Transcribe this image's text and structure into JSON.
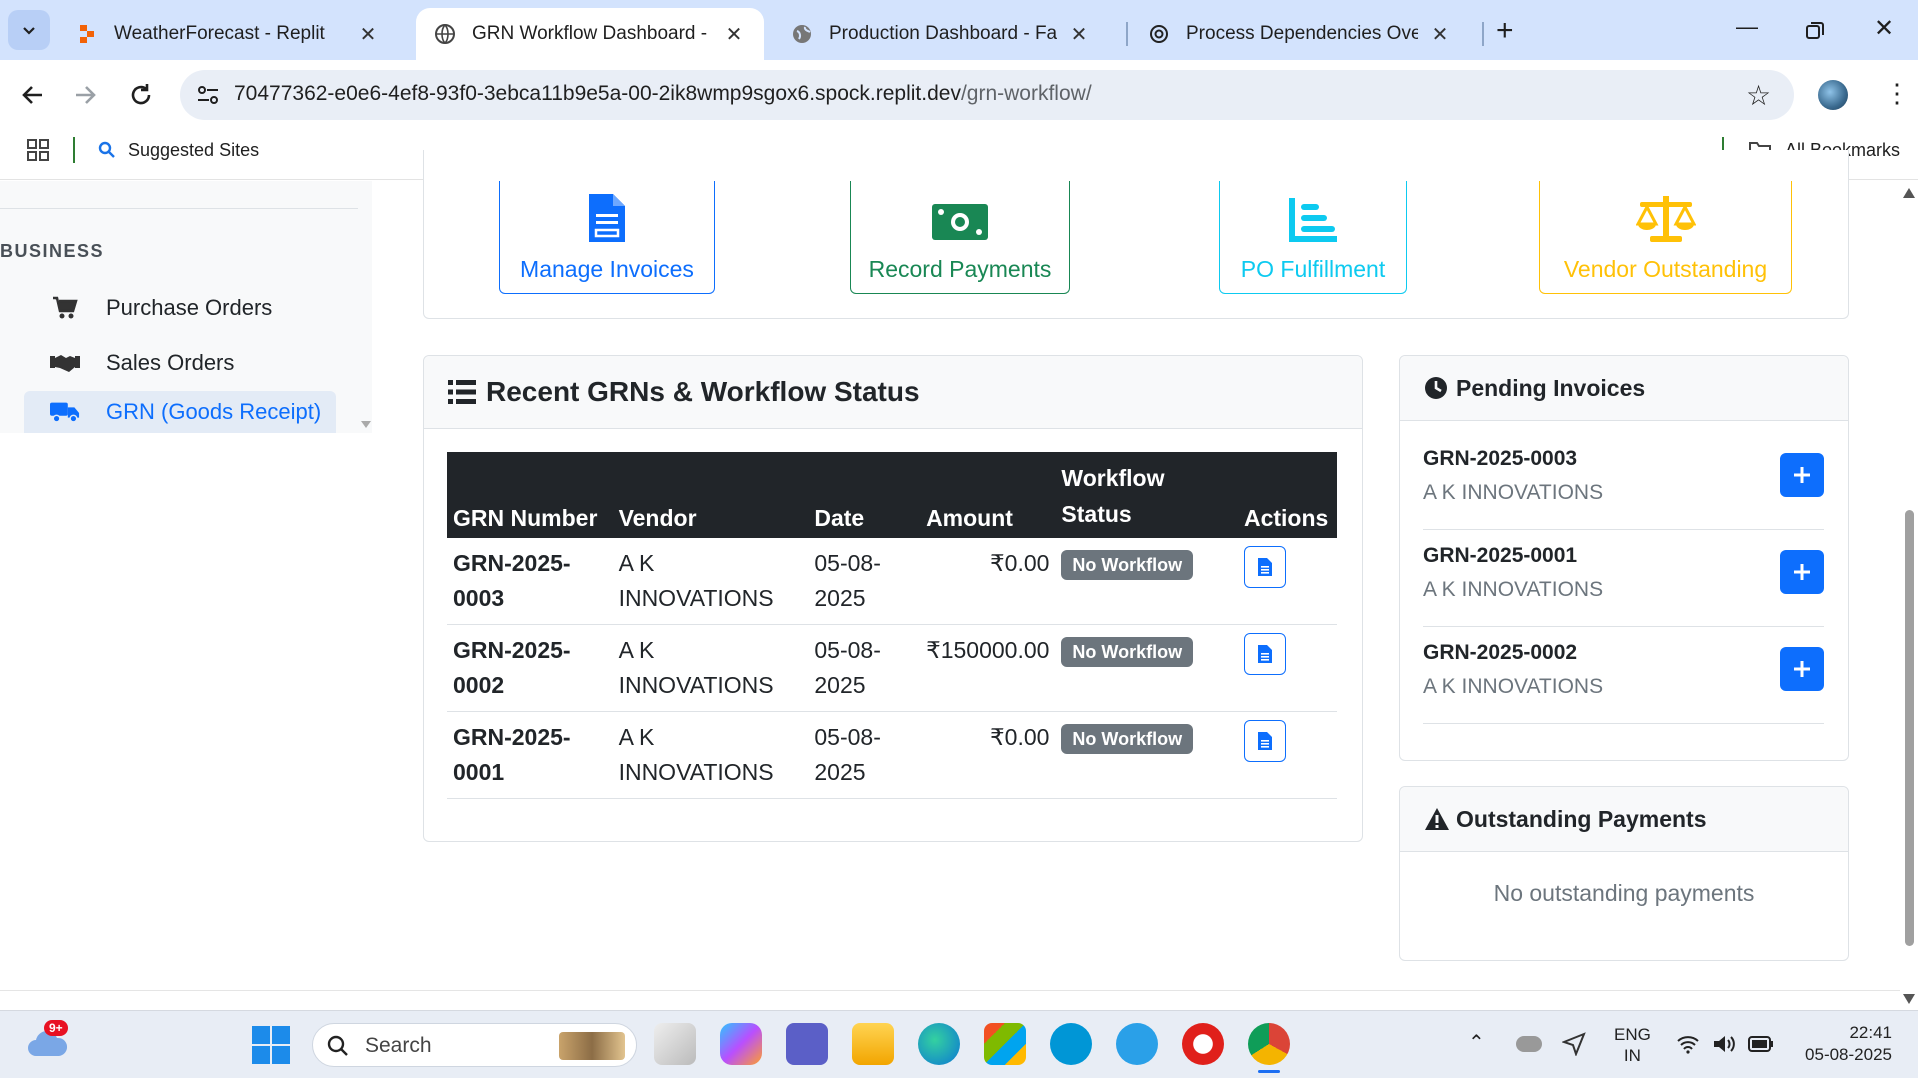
{
  "browser": {
    "tabs": [
      {
        "title": "WeatherForecast - Replit",
        "active": false
      },
      {
        "title": "GRN Workflow Dashboard - Factory",
        "active": true
      },
      {
        "title": "Production Dashboard - Factory",
        "active": false
      },
      {
        "title": "Process Dependencies Overview",
        "active": false
      }
    ],
    "url_main": "70477362-e0e6-4ef8-93f0-3ebca11b9e5a-00-2ik8wmp9sgox6.spock.replit.dev",
    "url_path": "/grn-workflow/",
    "bookmarks": {
      "suggested": "Suggested Sites",
      "all": "All Bookmarks"
    }
  },
  "sidebar": {
    "section": "BUSINESS",
    "items": [
      {
        "label": "Purchase Orders",
        "icon": "cart-icon"
      },
      {
        "label": "Sales Orders",
        "icon": "handshake-icon"
      },
      {
        "label": "GRN (Goods Receipt)",
        "icon": "truck-icon",
        "active": true
      }
    ]
  },
  "quick_actions": [
    {
      "label": "Manage Invoices",
      "icon": "invoice-icon",
      "color": "#0d6efd"
    },
    {
      "label": "Record Payments",
      "icon": "money-icon",
      "color": "#198754"
    },
    {
      "label": "PO Fulfillment",
      "icon": "chart-bars-icon",
      "color": "#0dcaf0"
    },
    {
      "label": "Vendor Outstanding",
      "icon": "balance-scale-icon",
      "color": "#ffc107"
    }
  ],
  "recent_grns": {
    "title": "Recent GRNs & Workflow Status",
    "columns": [
      "GRN Number",
      "Vendor",
      "Date",
      "Amount",
      "Workflow Status",
      "Actions"
    ],
    "rows": [
      {
        "grn": "GRN-2025-0003",
        "vendor": "A K INNOVATIONS",
        "date": "05-08-2025",
        "amount": "₹0.00",
        "status": "No Workflow"
      },
      {
        "grn": "GRN-2025-0002",
        "vendor": "A K INNOVATIONS",
        "date": "05-08-2025",
        "amount": "₹150000.00",
        "status": "No Workflow"
      },
      {
        "grn": "GRN-2025-0001",
        "vendor": "A K INNOVATIONS",
        "date": "05-08-2025",
        "amount": "₹0.00",
        "status": "No Workflow"
      }
    ]
  },
  "pending_invoices": {
    "title": "Pending Invoices",
    "items": [
      {
        "grn": "GRN-2025-0003",
        "vendor": "A K INNOVATIONS"
      },
      {
        "grn": "GRN-2025-0001",
        "vendor": "A K INNOVATIONS"
      },
      {
        "grn": "GRN-2025-0002",
        "vendor": "A K INNOVATIONS"
      }
    ]
  },
  "outstanding_payments": {
    "title": "Outstanding Payments",
    "empty": "No outstanding payments"
  },
  "taskbar": {
    "search_placeholder": "Search",
    "weather_badge": "9+",
    "lang_top": "ENG",
    "lang_bottom": "IN",
    "time": "22:41",
    "date": "05-08-2025"
  }
}
